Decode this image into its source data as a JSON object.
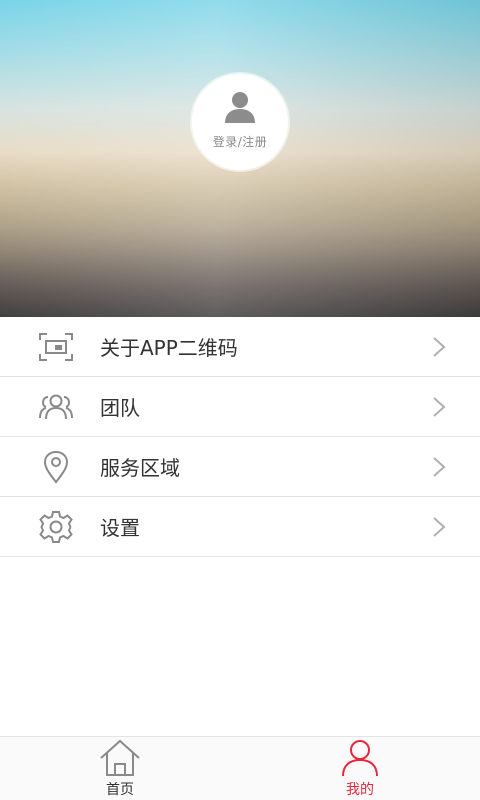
{
  "profile": {
    "login_label": "登录/注册",
    "avatar_icon": "user-silhouette-icon"
  },
  "menu": {
    "items": [
      {
        "label": "关于APP二维码",
        "icon": "qr-code-icon"
      },
      {
        "label": "团队",
        "icon": "team-icon"
      },
      {
        "label": "服务区域",
        "icon": "location-pin-icon"
      },
      {
        "label": "设置",
        "icon": "gear-icon"
      }
    ]
  },
  "tabbar": {
    "tabs": [
      {
        "label": "首页",
        "icon": "home-icon",
        "active": false
      },
      {
        "label": "我的",
        "icon": "person-icon",
        "active": true
      }
    ]
  },
  "colors": {
    "accent": "#e8263c",
    "text": "#333333",
    "icon_gray": "#8a8a8a"
  }
}
